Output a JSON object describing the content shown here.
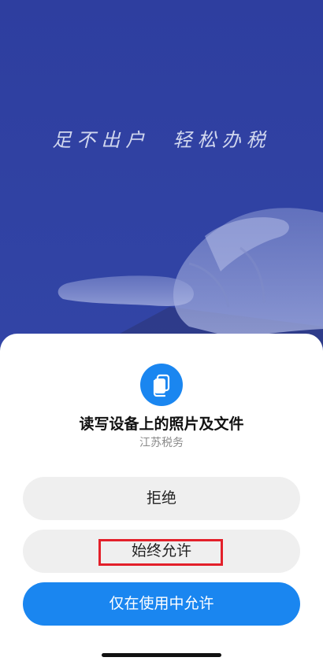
{
  "splash": {
    "slogan": "足不出户  轻松办税",
    "background_color": "#2f3f9e"
  },
  "permission_dialog": {
    "icon": "file-icon",
    "title": "读写设备上的照片及文件",
    "app_name": "江苏税务",
    "buttons": {
      "deny": "拒绝",
      "always_allow": "始终允许",
      "allow_while_using": "仅在使用中允许"
    },
    "accent_color": "#1a86f0",
    "highlight_color": "#e3202a"
  }
}
